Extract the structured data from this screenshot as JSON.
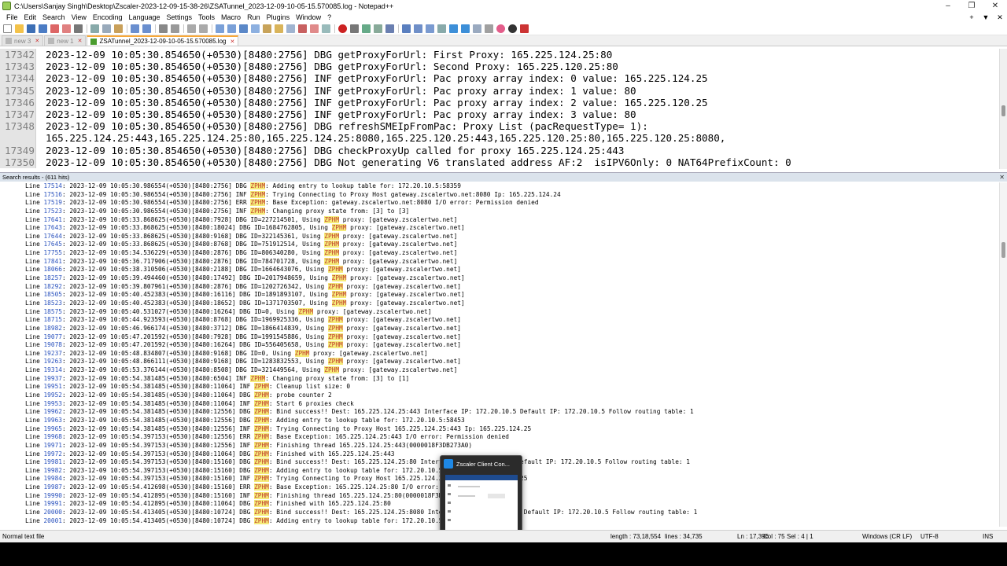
{
  "window": {
    "title": "C:\\Users\\Sanjay Singh\\Desktop\\Zscaler-2023-12-09-15-38-26\\ZSATunnel_2023-12-09-10-05-15.570085.log - Notepad++",
    "minimize": "–",
    "maximize": "❐",
    "close": "✕"
  },
  "menu": {
    "items": [
      "File",
      "Edit",
      "Search",
      "View",
      "Encoding",
      "Language",
      "Settings",
      "Tools",
      "Macro",
      "Run",
      "Plugins",
      "Window",
      "?"
    ],
    "right": [
      "+",
      "▼",
      "✕"
    ]
  },
  "tabs": [
    {
      "label": "new 3",
      "close": "✕"
    },
    {
      "label": "new 1",
      "close": "✕"
    },
    {
      "label": "ZSATunnel_2023-12-09-10-05-15.570085.log",
      "close": "✕"
    }
  ],
  "editor": {
    "lines": [
      {
        "num": "17342",
        "text": "2023-12-09 10:05:30.854650(+0530)[8480:2756] DBG getProxyForUrl: First Proxy: 165.225.124.25:80"
      },
      {
        "num": "17343",
        "text": "2023-12-09 10:05:30.854650(+0530)[8480:2756] DBG getProxyForUrl: Second Proxy: 165.225.120.25:80"
      },
      {
        "num": "17344",
        "text": "2023-12-09 10:05:30.854650(+0530)[8480:2756] INF getProxyForUrl: Pac proxy array index: 0 value: 165.225.124.25"
      },
      {
        "num": "17345",
        "text": "2023-12-09 10:05:30.854650(+0530)[8480:2756] INF getProxyForUrl: Pac proxy array index: 1 value: 80"
      },
      {
        "num": "17346",
        "text": "2023-12-09 10:05:30.854650(+0530)[8480:2756] INF getProxyForUrl: Pac proxy array index: 2 value: 165.225.120.25"
      },
      {
        "num": "17347",
        "text": "2023-12-09 10:05:30.854650(+0530)[8480:2756] INF getProxyForUrl: Pac proxy array index: 3 value: 80"
      },
      {
        "num": "17348",
        "text": "2023-12-09 10:05:30.854650(+0530)[8480:2756] DBG refreshSMEIpFromPac: Proxy List (pacRequestType= 1):"
      },
      {
        "num": "",
        "text": "165.225.124.25:443,165.225.124.25:80,165.225.124.25:8080,165.225.120.25:443,165.225.120.25:80,165.225.120.25:8080,"
      },
      {
        "num": "17349",
        "text": "2023-12-09 10:05:30.854650(+0530)[8480:2756] DBG checkProxyUp called for proxy 165.225.124.25:443"
      },
      {
        "num": "17350",
        "text": "2023-12-09 10:05:30.854650(+0530)[8480:2756] DBG Not generating V6 translated address AF:2  isIPV6Only: 0 NAT64PrefixCount: 0"
      }
    ]
  },
  "search": {
    "header": "Search results - (611 hits)",
    "close": "✕",
    "term": "ZPHM",
    "lines": [
      {
        "num": "17514",
        "pre": "2023-12-09 10:05:30.986554(+0530)[8480:2756] DBG ",
        "post": ": Adding entry to lookup table for: 172.20.10.5:58359"
      },
      {
        "num": "17516",
        "pre": "2023-12-09 10:05:30.986554(+0530)[8480:2756] INF ",
        "post": ": Trying Connecting to Proxy Host gateway.zscalertwo.net:8080 Ip: 165.225.124.24"
      },
      {
        "num": "17519",
        "pre": "2023-12-09 10:05:30.986554(+0530)[8480:2756] ERR ",
        "post": ": Base Exception: gateway.zscalertwo.net:8080 I/O error: Permission denied"
      },
      {
        "num": "17523",
        "pre": "2023-12-09 10:05:30.986554(+0530)[8480:2756] INF ",
        "post": ": Changing proxy state from: [3] to [3]"
      },
      {
        "num": "17641",
        "pre": "2023-12-09 10:05:33.868625(+0530)[8480:7928] DBG ID=227214501, Using ",
        "post": " proxy: [gateway.zscalertwo.net]"
      },
      {
        "num": "17643",
        "pre": "2023-12-09 10:05:33.868625(+0530)[8480:18024] DBG ID=1684762805, Using ",
        "post": " proxy: [gateway.zscalertwo.net]"
      },
      {
        "num": "17644",
        "pre": "2023-12-09 10:05:33.868625(+0530)[8480:9168] DBG ID=322145361, Using ",
        "post": " proxy: [gateway.zscalertwo.net]"
      },
      {
        "num": "17645",
        "pre": "2023-12-09 10:05:33.868625(+0530)[8480:8768] DBG ID=751912514, Using ",
        "post": " proxy: [gateway.zscalertwo.net]"
      },
      {
        "num": "17755",
        "pre": "2023-12-09 10:05:34.536229(+0530)[8480:2876] DBG ID=806340280, Using ",
        "post": " proxy: [gateway.zscalertwo.net]"
      },
      {
        "num": "17841",
        "pre": "2023-12-09 10:05:36.717906(+0530)[8480:2876] DBG ID=784701728, Using ",
        "post": " proxy: [gateway.zscalertwo.net]"
      },
      {
        "num": "18066",
        "pre": "2023-12-09 10:05:38.310506(+0530)[8480:2188] DBG ID=1664643076, Using ",
        "post": " proxy: [gateway.zscalertwo.net]"
      },
      {
        "num": "18257",
        "pre": "2023-12-09 10:05:39.494460(+0530)[8480:17492] DBG ID=2017948659, Using ",
        "post": " proxy: [gateway.zscalertwo.net]"
      },
      {
        "num": "18292",
        "pre": "2023-12-09 10:05:39.807961(+0530)[8480:2876] DBG ID=1202726342, Using ",
        "post": " proxy: [gateway.zscalertwo.net]"
      },
      {
        "num": "18505",
        "pre": "2023-12-09 10:05:40.452383(+0530)[8480:16116] DBG ID=1891893107, Using ",
        "post": " proxy: [gateway.zscalertwo.net]"
      },
      {
        "num": "18523",
        "pre": "2023-12-09 10:05:40.452383(+0530)[8480:18652] DBG ID=1371703507, Using ",
        "post": " proxy: [gateway.zscalertwo.net]"
      },
      {
        "num": "18575",
        "pre": "2023-12-09 10:05:40.531027(+0530)[8480:16264] DBG ID=0, Using ",
        "post": " proxy: [gateway.zscalertwo.net]"
      },
      {
        "num": "18715",
        "pre": "2023-12-09 10:05:44.923593(+0530)[8480:8768] DBG ID=1969925336, Using ",
        "post": " proxy: [gateway.zscalertwo.net]"
      },
      {
        "num": "18982",
        "pre": "2023-12-09 10:05:46.966174(+0530)[8480:3712] DBG ID=1866414839, Using ",
        "post": " proxy: [gateway.zscalertwo.net]"
      },
      {
        "num": "19077",
        "pre": "2023-12-09 10:05:47.201592(+0530)[8480:7928] DBG ID=1991545886, Using ",
        "post": " proxy: [gateway.zscalertwo.net]"
      },
      {
        "num": "19078",
        "pre": "2023-12-09 10:05:47.201592(+0530)[8480:16264] DBG ID=556405658, Using ",
        "post": " proxy: [gateway.zscalertwo.net]"
      },
      {
        "num": "19237",
        "pre": "2023-12-09 10:05:48.834807(+0530)[8480:9168] DBG ID=0, Using ",
        "post": " proxy: [gateway.zscalertwo.net]"
      },
      {
        "num": "19263",
        "pre": "2023-12-09 10:05:48.866111(+0530)[8480:9168] DBG ID=1283832553, Using ",
        "post": " proxy: [gateway.zscalertwo.net]"
      },
      {
        "num": "19314",
        "pre": "2023-12-09 10:05:53.376144(+0530)[8480:8508] DBG ID=321449564, Using ",
        "post": " proxy: [gateway.zscalertwo.net]"
      },
      {
        "num": "19937",
        "pre": "2023-12-09 10:05:54.381485(+0530)[8480:6504] INF ",
        "post": ": Changing proxy state from: [3] to [1]"
      },
      {
        "num": "19951",
        "pre": "2023-12-09 10:05:54.381485(+0530)[8480:11064] INF ",
        "post": ": Cleanup list size: 0"
      },
      {
        "num": "19952",
        "pre": "2023-12-09 10:05:54.381485(+0530)[8480:11064] DBG ",
        "post": ": probe counter 2"
      },
      {
        "num": "19953",
        "pre": "2023-12-09 10:05:54.381485(+0530)[8480:11064] INF ",
        "post": ": Start 6 proxies check"
      },
      {
        "num": "19962",
        "pre": "2023-12-09 10:05:54.381485(+0530)[8480:12556] DBG ",
        "post": ": Bind success!! Dest: 165.225.124.25:443 Interface IP: 172.20.10.5 Default IP: 172.20.10.5 Follow routing table: 1"
      },
      {
        "num": "19963",
        "pre": "2023-12-09 10:05:54.381485(+0530)[8480:12556] DBG ",
        "post": ": Adding entry to lookup table for: 172.20.10.5:58453"
      },
      {
        "num": "19965",
        "pre": "2023-12-09 10:05:54.381485(+0530)[8480:12556] INF ",
        "post": ": Trying Connecting to Proxy Host 165.225.124.25:443 Ip: 165.225.124.25"
      },
      {
        "num": "19968",
        "pre": "2023-12-09 10:05:54.397153(+0530)[8480:12556] ERR ",
        "post": ": Base Exception: 165.225.124.25:443 I/O error: Permission denied"
      },
      {
        "num": "19971",
        "pre": "2023-12-09 10:05:54.397153(+0530)[8480:12556] INF ",
        "post": ": Finishing thread 165.225.124.25:443(0000018F3DB273A0)"
      },
      {
        "num": "19972",
        "pre": "2023-12-09 10:05:54.397153(+0530)[8480:11064] DBG ",
        "post": ": Finished with 165.225.124.25:443"
      },
      {
        "num": "19981",
        "pre": "2023-12-09 10:05:54.397153(+0530)[8480:15160] DBG ",
        "post": ": Bind success!! Dest: 165.225.124.25:80 Interface IP: 172.20.10.5 Default IP: 172.20.10.5 Follow routing table: 1"
      },
      {
        "num": "19982",
        "pre": "2023-12-09 10:05:54.397153(+0530)[8480:15160] DBG ",
        "post": ": Adding entry to lookup table for: 172.20.10.5:58454"
      },
      {
        "num": "19984",
        "pre": "2023-12-09 10:05:54.397153(+0530)[8480:15160] INF ",
        "post": ": Trying Connecting to Proxy Host 165.225.124.25:80 Ip: 165.225.124.25"
      },
      {
        "num": "19987",
        "pre": "2023-12-09 10:05:54.412698(+0530)[8480:15160] ERR ",
        "post": ": Base Exception: 165.225.124.25:80 I/O error: Permission denied"
      },
      {
        "num": "19990",
        "pre": "2023-12-09 10:05:54.412895(+0530)[8480:15160] INF ",
        "post": ": Finishing thread 165.225.124.25:80(0000018F3DB27400)"
      },
      {
        "num": "19991",
        "pre": "2023-12-09 10:05:54.412895(+0530)[8480:11064] DBG ",
        "post": ": Finished with 165.225.124.25:80"
      },
      {
        "num": "20000",
        "pre": "2023-12-09 10:05:54.413405(+0530)[8480:10724] DBG ",
        "post": ": Bind success!! Dest: 165.225.124.25:8080 Interface IP: 172.20.10.5 Default IP: 172.20.10.5 Follow routing table: 1"
      },
      {
        "num": "20001",
        "pre": "2023-12-09 10:05:54.413405(+0530)[8480:10724] DBG ",
        "post": ": Adding entry to lookup table for: 172.20.10.5:58455"
      }
    ]
  },
  "popup": {
    "title": "Zscaler Client Con..."
  },
  "status": {
    "mode": "Normal text file",
    "length": "length : 73,18,554",
    "lines": "lines : 34,735",
    "position": "Ln : 17,396",
    "col": "Col : 75",
    "sel": "Sel : 4 | 1",
    "eol": "Windows (CR LF)",
    "encoding": "UTF-8",
    "ins": "INS"
  },
  "colors": {
    "highlight": "#f5ec7a",
    "highlight_text": "#c0392b",
    "line_link": "#2a52be",
    "active_tab_accent": "#f7a839"
  }
}
